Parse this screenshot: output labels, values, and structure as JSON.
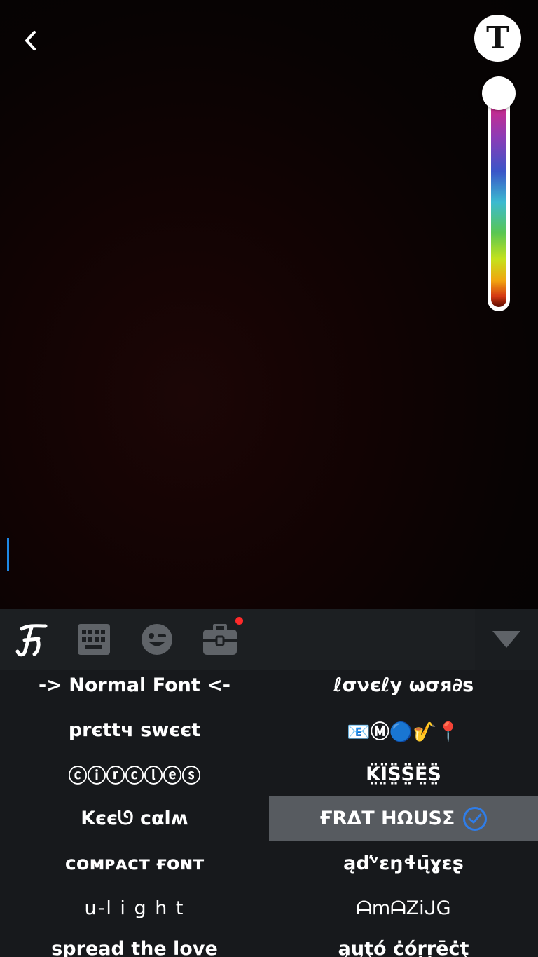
{
  "icons": {
    "back": "chevron-left-icon",
    "text_style": "text-style-icon",
    "app_logo": "fonts-logo-icon",
    "keyboard": "keyboard-icon",
    "emoji": "emoji-icon",
    "toolbox": "toolbox-icon",
    "collapse": "triangle-down-icon",
    "selected": "check-circle-icon"
  },
  "text_button": {
    "glyph": "T"
  },
  "colors": {
    "accent": "#2f7de8",
    "notification_dot": "#ff2a2a",
    "selected_row": "#575b60",
    "panel": "#17191c"
  },
  "fonts": {
    "left": [
      "-> Normal Font <-",
      "prєttч swєєt",
      "ⓒⓘⓡⓒⓛⓔⓢ",
      "Kєєᘎ cαlʍ",
      "ᴄᴏᴍᴘᴀᴄᴛ ғᴏɴᴛ",
      "u-l i g h t",
      "spread the love"
    ],
    "right": [
      "ℓσνєℓу ωσя∂ѕ",
      "📧Ⓜ🔵🎷📍",
      "K̤̈Ï̤S̤̈S̤̈Ë̤S̤̈",
      "ҒRΔT HΩUSΣ",
      "ąďᵛɛŋɬų̄ɣɛʂ",
      "ᗩmᗩZiᒍG",
      "ąųţó ċóŗŗēċţ"
    ],
    "selected": "ҒRΔT HΩUSΣ"
  }
}
